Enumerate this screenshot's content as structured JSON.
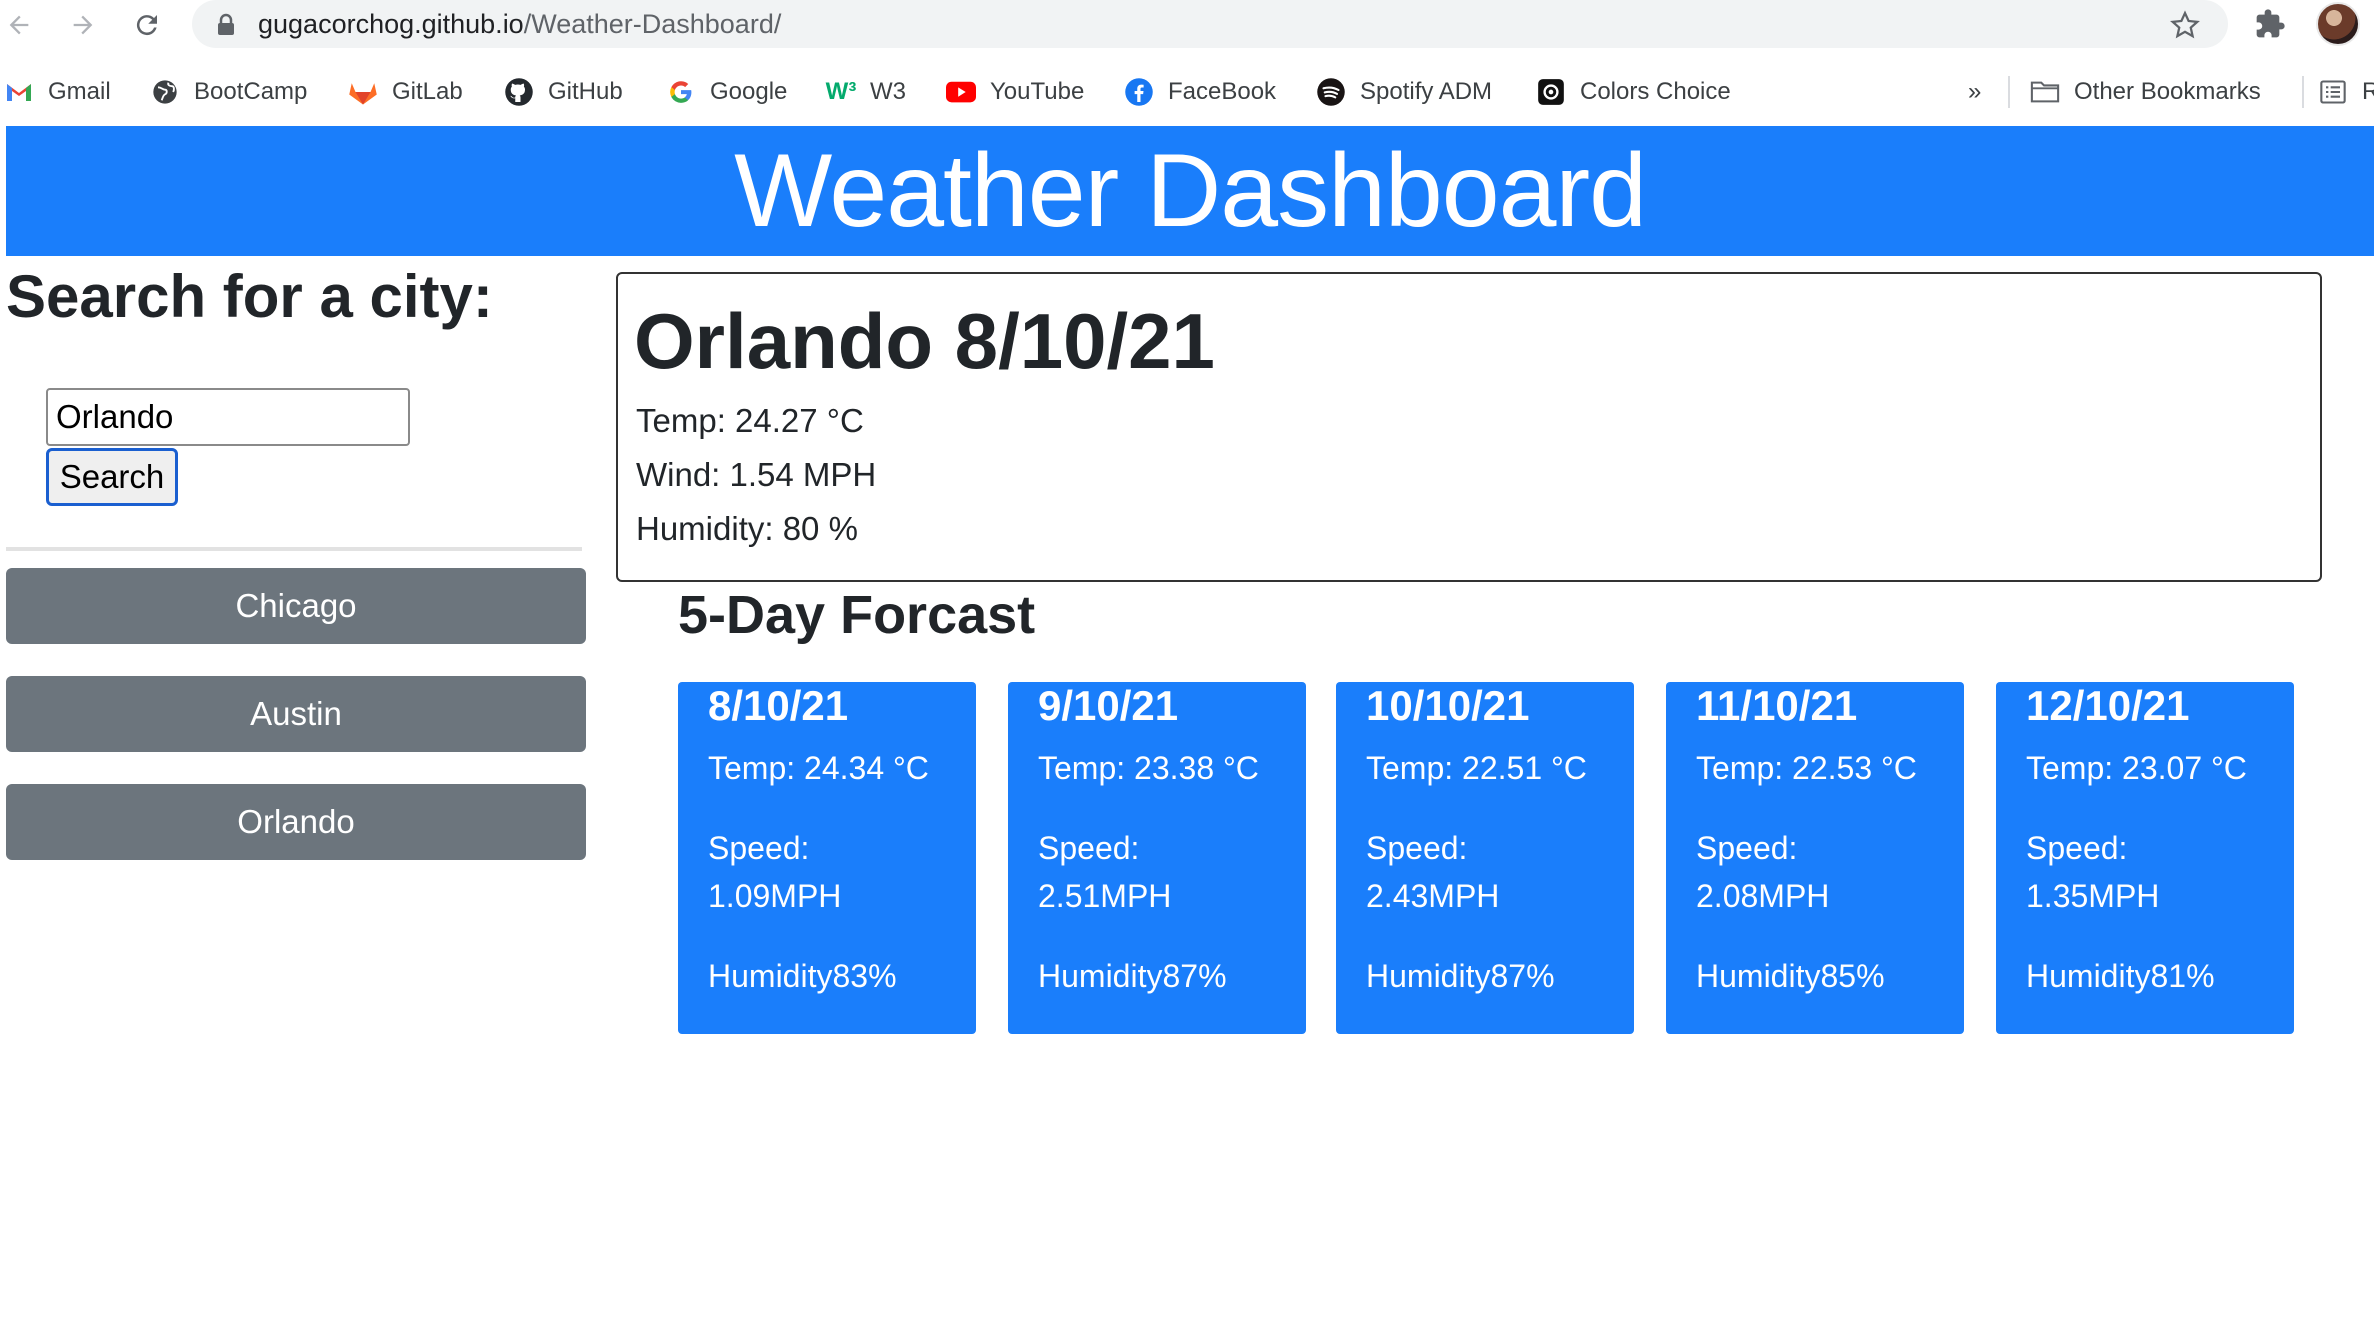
{
  "browser": {
    "url_host": "gugacorchog.github.io",
    "url_path": "/Weather-Dashboard/",
    "bookmarks": [
      {
        "label": "Gmail",
        "icon": "gmail-icon"
      },
      {
        "label": "BootCamp",
        "icon": "globe-icon"
      },
      {
        "label": "GitLab",
        "icon": "gitlab-icon"
      },
      {
        "label": "GitHub",
        "icon": "github-icon"
      },
      {
        "label": "Google",
        "icon": "google-icon"
      },
      {
        "label": "W3",
        "icon": "w3-icon"
      },
      {
        "label": "YouTube",
        "icon": "youtube-icon"
      },
      {
        "label": "FaceBook",
        "icon": "facebook-icon"
      },
      {
        "label": "Spotify ADM",
        "icon": "spotify-icon"
      },
      {
        "label": "Colors Choice",
        "icon": "colors-icon"
      }
    ],
    "overflow_label": "»",
    "other_bookmarks": "Other Bookmarks",
    "reading_list_partial": "R"
  },
  "header": {
    "title": "Weather Dashboard"
  },
  "search": {
    "title": "Search for a city:",
    "input_value": "Orlando",
    "button_label": "Search"
  },
  "history": [
    "Chicago",
    "Austin",
    "Orlando"
  ],
  "current": {
    "city_date": "Orlando 8/10/21",
    "temp": "Temp: 24.27 °C",
    "wind": "Wind: 1.54 MPH",
    "humidity": "Humidity: 80 %"
  },
  "forecast": {
    "title": "5-Day Forcast",
    "days": [
      {
        "date": "8/10/21",
        "temp": "Temp: 24.34 °C",
        "speed_label": "Speed:",
        "speed": "1.09MPH",
        "humidity": "Humidity83%"
      },
      {
        "date": "9/10/21",
        "temp": "Temp: 23.38 °C",
        "speed_label": "Speed:",
        "speed": "2.51MPH",
        "humidity": "Humidity87%"
      },
      {
        "date": "10/10/21",
        "temp": "Temp: 22.51 °C",
        "speed_label": "Speed:",
        "speed": "2.43MPH",
        "humidity": "Humidity87%"
      },
      {
        "date": "11/10/21",
        "temp": "Temp: 22.53 °C",
        "speed_label": "Speed:",
        "speed": "2.08MPH",
        "humidity": "Humidity85%"
      },
      {
        "date": "12/10/21",
        "temp": "Temp: 23.07 °C",
        "speed_label": "Speed:",
        "speed": "1.35MPH",
        "humidity": "Humidity81%"
      }
    ]
  },
  "colors": {
    "primary": "#1a7efb",
    "secondary": "#6c757d"
  }
}
